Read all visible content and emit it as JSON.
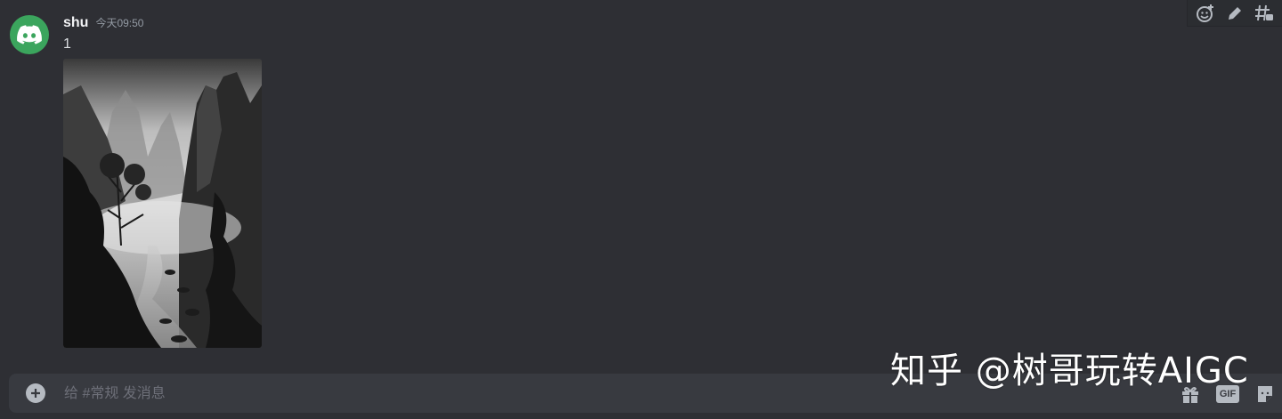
{
  "message": {
    "username": "shu",
    "timestamp": "今天09:50",
    "text": "1",
    "avatar_icon": "discord-logo-icon",
    "avatar_color": "#3ba55d"
  },
  "toolbar": {
    "icons": [
      "add-reaction-icon",
      "edit-pencil-icon",
      "create-thread-icon"
    ]
  },
  "composer": {
    "placeholder": "给 #常规 发消息",
    "gif_label": "GIF",
    "icons": [
      "add-plus-icon",
      "gift-icon",
      "gif-icon",
      "sticker-icon"
    ]
  },
  "watermark": {
    "text": "知乎 @树哥玩转AIGC"
  }
}
